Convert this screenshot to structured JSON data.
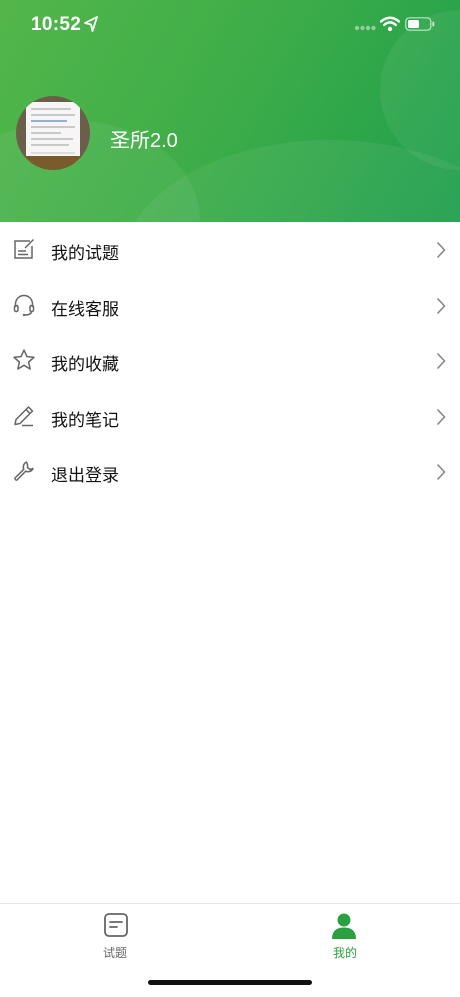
{
  "status_bar": {
    "time": "10:52"
  },
  "profile": {
    "name": "圣所2.0"
  },
  "menu": {
    "items": [
      {
        "label": "我的试题",
        "icon": "edit-doc-icon"
      },
      {
        "label": "在线客服",
        "icon": "headset-icon"
      },
      {
        "label": "我的收藏",
        "icon": "star-icon"
      },
      {
        "label": "我的笔记",
        "icon": "pencil-icon"
      },
      {
        "label": "退出登录",
        "icon": "wrench-icon"
      }
    ]
  },
  "tabbar": {
    "tabs": [
      {
        "label": "试题",
        "active": false
      },
      {
        "label": "我的",
        "active": true
      }
    ],
    "active_color": "#2aa141",
    "inactive_color": "#666666"
  },
  "colors": {
    "header_start": "#53b64b",
    "header_end": "#1f9e4d"
  }
}
